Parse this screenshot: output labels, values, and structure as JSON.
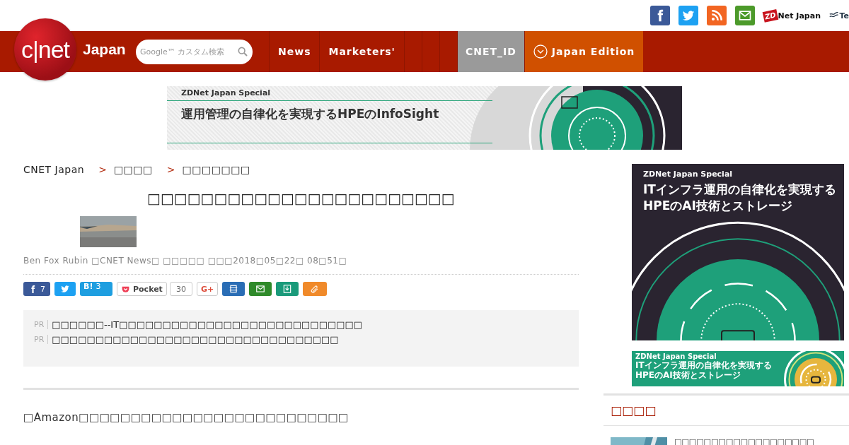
{
  "top_links": [
    {
      "kind": "facebook"
    },
    {
      "kind": "twitter"
    },
    {
      "kind": "rss"
    },
    {
      "kind": "mail"
    },
    {
      "kind": "zdnet",
      "label": "Net Japan",
      "badge": "ZD"
    },
    {
      "kind": "tech",
      "label": "Te"
    }
  ],
  "logo": {
    "text": "c|net",
    "edition": "Japan"
  },
  "search": {
    "placeholder": "Google™ カスタム検索"
  },
  "nav": [
    {
      "label": "News",
      "kind": "link"
    },
    {
      "label": "Marketers'",
      "kind": "link"
    },
    {
      "kind": "empty"
    },
    {
      "kind": "empty"
    },
    {
      "kind": "empty"
    },
    {
      "label": "CNET_ID",
      "kind": "id"
    },
    {
      "label": "Japan Edition",
      "kind": "edition"
    }
  ],
  "top_banner": {
    "eyebrow": "ZDNet Japan Special",
    "headline": "運用管理の自律化を実現するHPEのInfoSight"
  },
  "breadcrumb": [
    {
      "label": "CNET Japan"
    },
    {
      "sep": ">",
      "label": "□□□□"
    },
    {
      "sep": ">",
      "label": "□□□□□□□"
    }
  ],
  "article": {
    "title": "□□□□□□□□□□□□□□□□□□□□□□□",
    "byline": "Ben Fox Rubin □CNET News□ □□□□□ □□□2018□05□22□ 08□51□",
    "share": [
      {
        "kind": "facebook",
        "count": "7"
      },
      {
        "kind": "twitter"
      },
      {
        "kind": "hatena",
        "label": "B!",
        "count": "3"
      },
      {
        "kind": "pocket",
        "label": "Pocket",
        "count": "30"
      },
      {
        "kind": "gplus",
        "label": "G+"
      },
      {
        "kind": "print"
      },
      {
        "kind": "mail"
      },
      {
        "kind": "save"
      },
      {
        "kind": "clip"
      }
    ],
    "pr": [
      {
        "tag": "PR",
        "text": "□□□□□□--IT□□□□□□□□□□□□□□□□□□□□□□□□□□□□"
      },
      {
        "tag": "PR",
        "text": "□□□□□□□□□□□□□□□□□□□□□□□□□□□□□□□□□"
      }
    ],
    "lead": "□Amazon□□□□□□□□□□□□□□□□□□□□□□□□□□"
  },
  "side_ad": {
    "eyebrow": "ZDNet Japan Special",
    "lines": [
      "ITインフラ運用の自律化を実現する",
      "HPEのAI技術とストレージ"
    ]
  },
  "side_ad_small": {
    "eyebrow": "ZDNet Japan Special",
    "lines": [
      "ITインフラ運用の自律化を実現する",
      "HPEのAI技術とストレージ"
    ]
  },
  "side_section": {
    "heading": "□□□□",
    "items": [
      {
        "title": "□□□□□□□□□□□□□□□□□□□"
      }
    ]
  }
}
